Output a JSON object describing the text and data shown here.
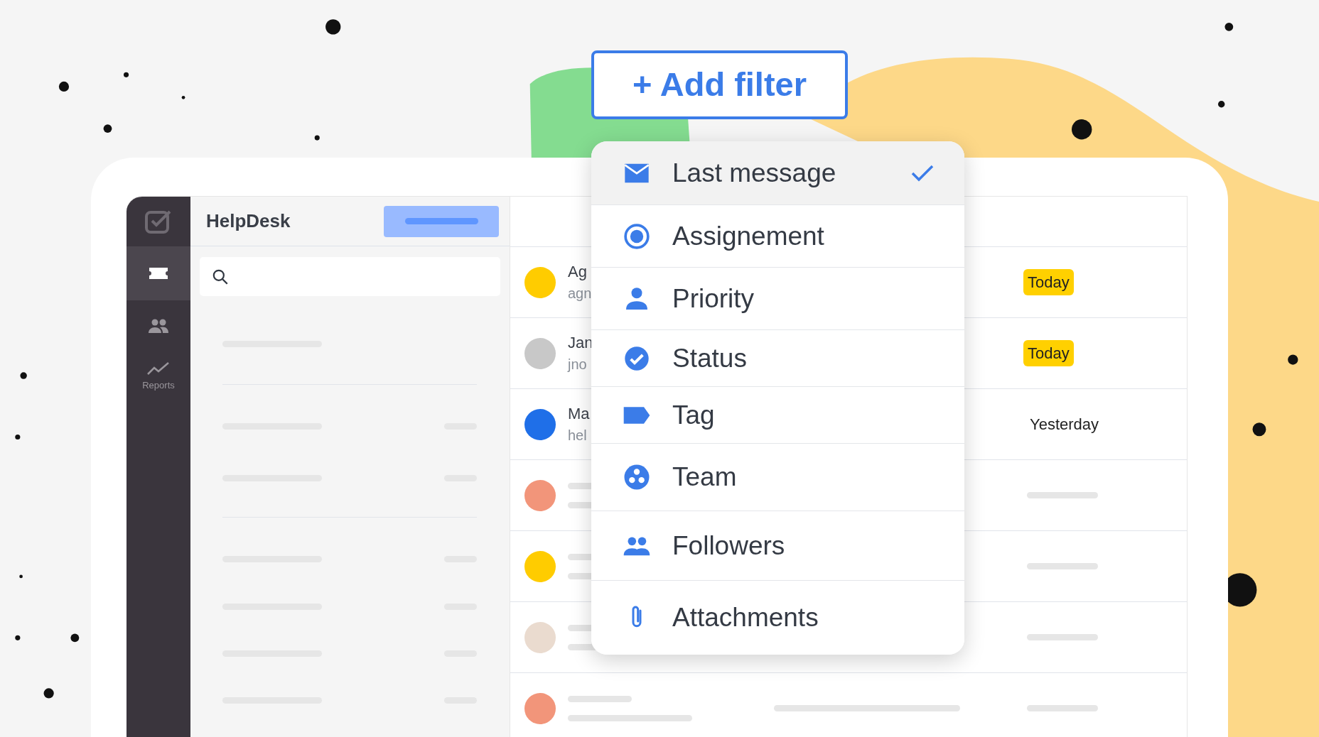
{
  "add_filter_button": "+ Add filter",
  "sidebar": {
    "items": [
      {
        "selected": true
      },
      {
        "selected": false
      },
      {
        "label": "Reports",
        "selected": false
      }
    ]
  },
  "panel": {
    "title": "HelpDesk"
  },
  "tickets": {
    "rows": [
      {
        "name": "Ag",
        "email": "agn",
        "date": "Today",
        "highlighted": true
      },
      {
        "name": "Jan",
        "email": "jno",
        "date": "Today",
        "highlighted": true
      },
      {
        "name": "Ma",
        "email": "hel",
        "date": "Yesterday",
        "highlighted": false
      },
      {},
      {},
      {},
      {}
    ]
  },
  "filter_menu": {
    "items": [
      {
        "label": "Last message",
        "selected": true
      },
      {
        "label": "Assignement",
        "selected": false
      },
      {
        "label": "Priority",
        "selected": false
      },
      {
        "label": "Status",
        "selected": false
      },
      {
        "label": "Tag",
        "selected": false
      },
      {
        "label": "Team",
        "selected": false
      },
      {
        "label": "Followers",
        "selected": false
      },
      {
        "label": "Attachments",
        "selected": false
      }
    ]
  }
}
